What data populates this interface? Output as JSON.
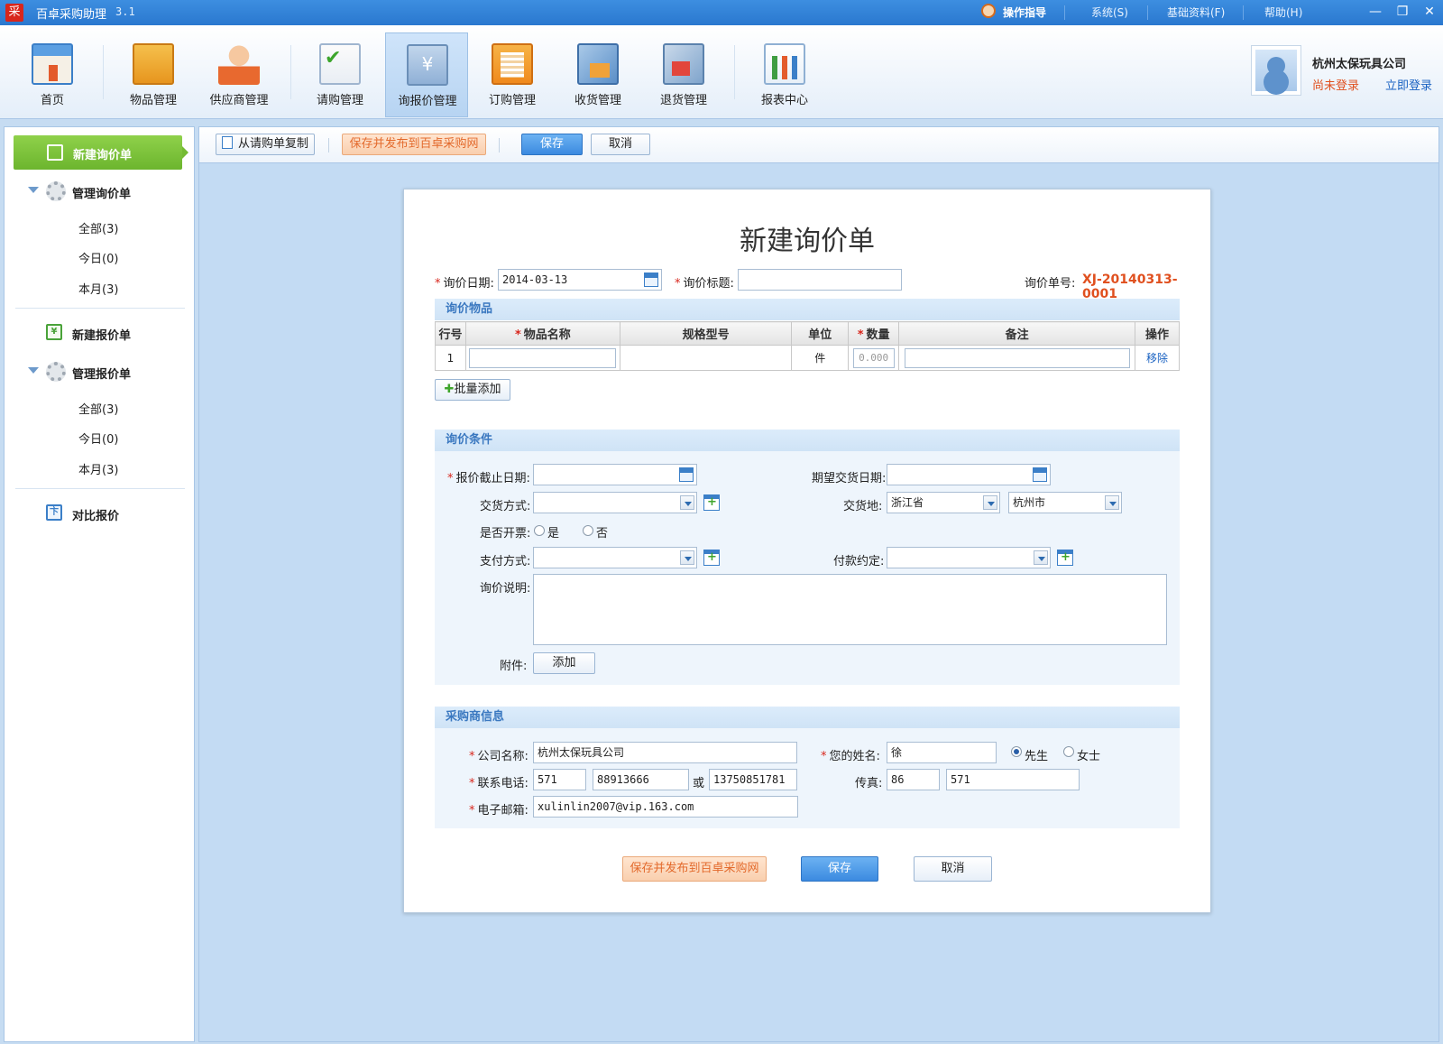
{
  "app": {
    "logo_char": "采",
    "title": "百卓采购助理",
    "version": "3.1"
  },
  "topmenu": {
    "guide": "操作指导",
    "system": "系统(S)",
    "basic": "基础资料(F)",
    "help": "帮助(H)"
  },
  "window": {
    "minimize": "—",
    "restore": "❐",
    "close": "✕"
  },
  "toolbar": {
    "items": [
      {
        "label": "首页",
        "icon": "home-icon"
      },
      {
        "label": "物品管理",
        "icon": "goods-icon"
      },
      {
        "label": "供应商管理",
        "icon": "supplier-icon"
      },
      {
        "label": "请购管理",
        "icon": "request-icon"
      },
      {
        "label": "询报价管理",
        "icon": "quote-icon"
      },
      {
        "label": "订购管理",
        "icon": "order-icon"
      },
      {
        "label": "收货管理",
        "icon": "receive-icon"
      },
      {
        "label": "退货管理",
        "icon": "return-icon"
      },
      {
        "label": "报表中心",
        "icon": "report-icon"
      }
    ],
    "active_index": 4,
    "quote_symbol": "¥"
  },
  "user": {
    "company": "杭州太保玩具公司",
    "status": "尚未登录",
    "login_link": "立即登录"
  },
  "sidebar": {
    "new_inquiry": "新建询价单",
    "manage_inquiry": "管理询价单",
    "inquiry_sub": [
      "全部(3)",
      "今日(0)",
      "本月(3)"
    ],
    "new_quote": "新建报价单",
    "manage_quote": "管理报价单",
    "quote_sub": [
      "全部(3)",
      "今日(0)",
      "本月(3)"
    ],
    "compare": "对比报价",
    "quote_icon_symbol": "¥",
    "compare_icon_symbol": "卞"
  },
  "actionbar": {
    "copy": "从请购单复制",
    "publish": "保存并发布到百卓采购网",
    "save": "保存",
    "cancel": "取消"
  },
  "form": {
    "title": "新建询价单",
    "date_label": "询价日期:",
    "date_value": "2014-03-13",
    "subject_label": "询价标题:",
    "subject_value": "",
    "order_no_label": "询价单号:",
    "order_no": "XJ-20140313-0001",
    "items_section": "询价物品",
    "columns": [
      "行号",
      "物品名称",
      "规格型号",
      "单位",
      "数量",
      "备注",
      "操作"
    ],
    "rows": [
      {
        "no": "1",
        "name": "",
        "spec": "",
        "unit": "件",
        "qty": "0.000",
        "note": "",
        "action": "移除"
      }
    ],
    "batch_add": "批量添加",
    "cond_section": "询价条件",
    "deadline_label": "报价截止日期:",
    "delivery_date_label": "期望交货日期:",
    "delivery_method_label": "交货方式:",
    "delivery_place_label": "交货地:",
    "province": "浙江省",
    "city": "杭州市",
    "invoice_label": "是否开票:",
    "invoice_yes": "是",
    "invoice_no": "否",
    "payment_method_label": "支付方式:",
    "payment_terms_label": "付款约定:",
    "desc_label": "询价说明:",
    "attach_label": "附件:",
    "attach_button": "添加",
    "buyer_section": "采购商信息",
    "company_label": "公司名称:",
    "company_value": "杭州太保玩具公司",
    "name_label": "您的姓名:",
    "name_value": "徐",
    "mr": "先生",
    "ms": "女士",
    "phone_label": "联系电话:",
    "phone_area": "571",
    "phone_num": "88913666",
    "or_label": "或",
    "mobile": "13750851781",
    "fax_label": "传真:",
    "fax_country": "86",
    "fax_area": "571",
    "email_label": "电子邮箱:",
    "email_value": "xulinlin2007@vip.163.com",
    "publish_button": "保存并发布到百卓采购网",
    "save_button": "保存",
    "cancel_button": "取消"
  },
  "colors": {
    "accent": "#3b8ae0",
    "sidebar_active": "#74bb33",
    "required": "#d8261c",
    "order_no": "#e0501f"
  }
}
